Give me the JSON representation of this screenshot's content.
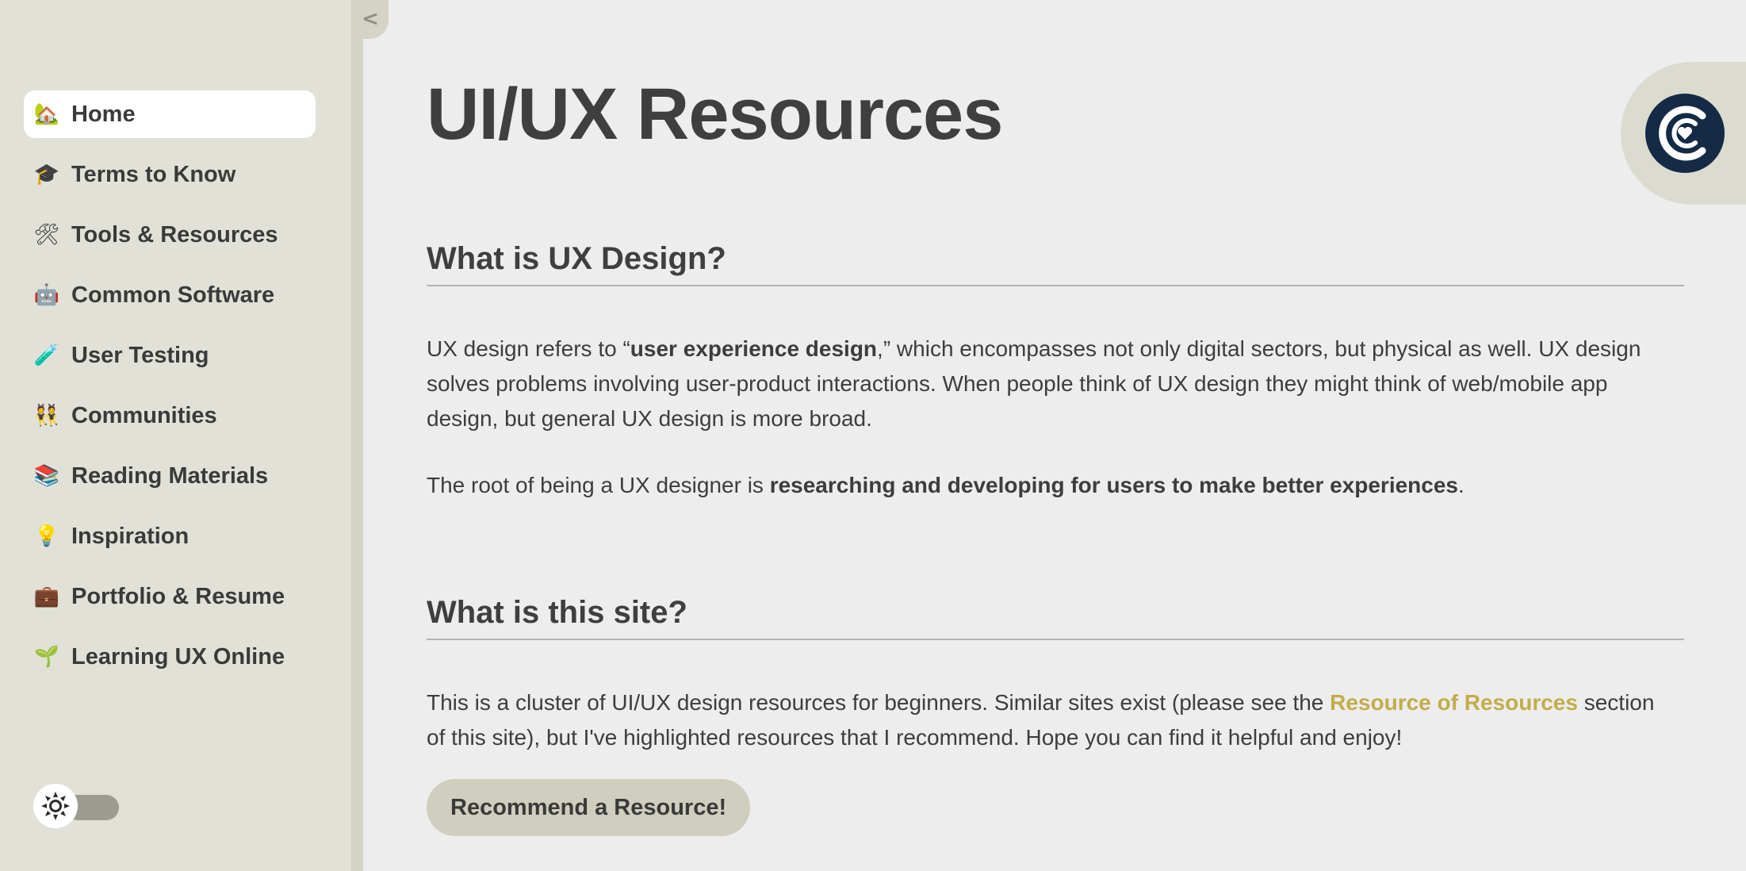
{
  "sidebar": {
    "collapse_glyph": "<",
    "items": [
      {
        "label": "Home",
        "icon": "🏡",
        "icon_name": "house-icon",
        "active": true
      },
      {
        "label": "Terms to Know",
        "icon": "🎓",
        "icon_name": "graduation-cap-icon",
        "active": false
      },
      {
        "label": "Tools & Resources",
        "icon": "🛠",
        "icon_name": "tools-icon",
        "active": false
      },
      {
        "label": "Common Software",
        "icon": "🤖",
        "icon_name": "robot-icon",
        "active": false
      },
      {
        "label": "User Testing",
        "icon": "🧪",
        "icon_name": "test-tube-icon",
        "active": false
      },
      {
        "label": "Communities",
        "icon": "👯",
        "icon_name": "people-icon",
        "active": false
      },
      {
        "label": "Reading Materials",
        "icon": "📚",
        "icon_name": "books-icon",
        "active": false
      },
      {
        "label": "Inspiration",
        "icon": "💡",
        "icon_name": "light-bulb-icon",
        "active": false
      },
      {
        "label": "Portfolio & Resume",
        "icon": "💼",
        "icon_name": "briefcase-icon",
        "active": false
      },
      {
        "label": "Learning UX Online",
        "icon": "🌱",
        "icon_name": "seedling-icon",
        "active": false
      }
    ],
    "theme_toggle": {
      "icon_name": "sun-icon",
      "state": "light"
    }
  },
  "main": {
    "title": "UI/UX Resources",
    "sections": [
      {
        "heading": "What is UX Design?",
        "p1_a": "UX design refers to “",
        "p1_bold": "user experience design",
        "p1_b": ",” which encompasses not only digital sectors, but physical as well. UX design solves problems involving user-product interactions. When people think of UX design they might think of web/mobile app design, but general UX design is more broad.",
        "p2_a": "The root of being a UX designer is ",
        "p2_bold": "researching and developing for users to make better experiences",
        "p2_b": "."
      },
      {
        "heading": "What is this site?",
        "p1_a": "This is a cluster of UI/UX design resources for beginners. Similar sites exist (please see the ",
        "p1_link": "Resource of Resources",
        "p1_b": " section of this site), but I've highlighted resources that I recommend. Hope you can find it helpful and enjoy!"
      }
    ],
    "recommend_button": "Recommend a Resource!"
  },
  "logo": {
    "icon_name": "heart-c-logo-icon"
  },
  "colors": {
    "sidebar_bg": "#e2e1d8",
    "main_bg": "#ededed",
    "link": "#c2ad4b",
    "button_bg": "#cfcebf",
    "logo_dark": "#142a45"
  }
}
